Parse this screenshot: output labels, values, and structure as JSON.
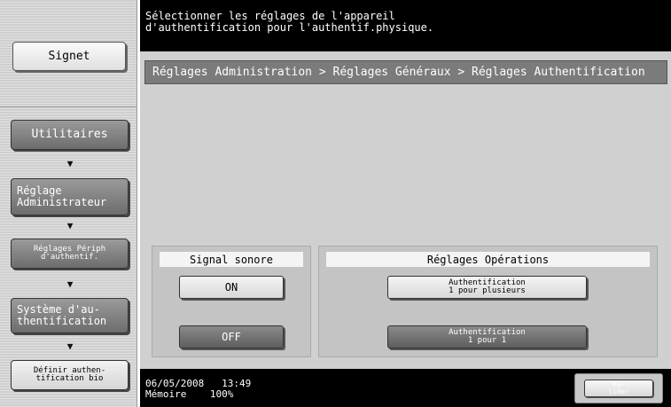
{
  "left_nav": {
    "signet_label": "Signet",
    "items": [
      {
        "label": "Utilitaires"
      },
      {
        "label": "Réglage\nAdministrateur"
      },
      {
        "label": "Réglages Périph\nd'authentif."
      },
      {
        "label": "Système d'au-\nthentification"
      },
      {
        "label": "Définir authen-\ntification bio"
      }
    ],
    "arrow_icon": "arrow-down-icon"
  },
  "message": "Sélectionner les réglages de l'appareil\nd'authentification pour l'authentif.physique.",
  "breadcrumb": "Réglages Administration > Réglages Généraux > Réglages Authentification",
  "signal_group": {
    "title": "Signal sonore",
    "on_label": "ON",
    "off_label": "OFF",
    "selected": "OFF"
  },
  "operations_group": {
    "title": "Réglages Opérations",
    "option_multi": "Authentification\n1 pour plusieurs",
    "option_single": "Authentification\n1 pour 1",
    "selected": "Authentification 1 pour 1"
  },
  "status": {
    "date": "06/05/2008",
    "time": "13:49",
    "memory_label": "Mémoire",
    "memory_value": "100%"
  },
  "valider_label": "Va-\nlider"
}
